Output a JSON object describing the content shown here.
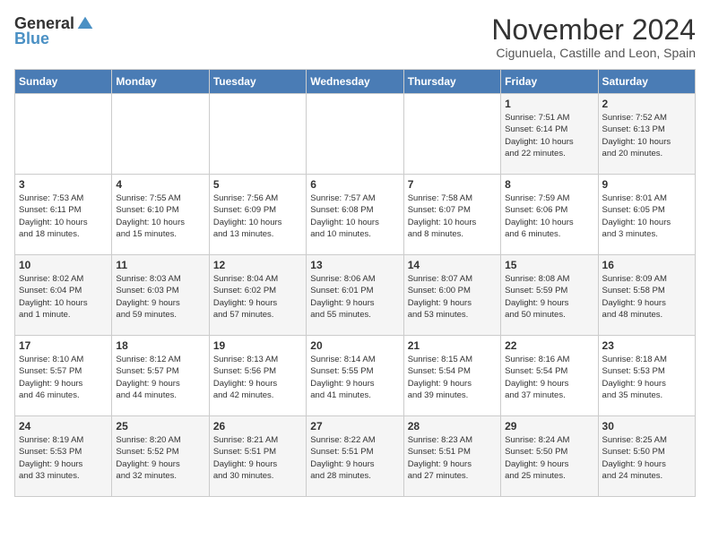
{
  "header": {
    "logo_general": "General",
    "logo_blue": "Blue",
    "month_title": "November 2024",
    "location": "Cigunuela, Castille and Leon, Spain"
  },
  "weekdays": [
    "Sunday",
    "Monday",
    "Tuesday",
    "Wednesday",
    "Thursday",
    "Friday",
    "Saturday"
  ],
  "weeks": [
    [
      {
        "day": "",
        "info": ""
      },
      {
        "day": "",
        "info": ""
      },
      {
        "day": "",
        "info": ""
      },
      {
        "day": "",
        "info": ""
      },
      {
        "day": "",
        "info": ""
      },
      {
        "day": "1",
        "info": "Sunrise: 7:51 AM\nSunset: 6:14 PM\nDaylight: 10 hours\nand 22 minutes."
      },
      {
        "day": "2",
        "info": "Sunrise: 7:52 AM\nSunset: 6:13 PM\nDaylight: 10 hours\nand 20 minutes."
      }
    ],
    [
      {
        "day": "3",
        "info": "Sunrise: 7:53 AM\nSunset: 6:11 PM\nDaylight: 10 hours\nand 18 minutes."
      },
      {
        "day": "4",
        "info": "Sunrise: 7:55 AM\nSunset: 6:10 PM\nDaylight: 10 hours\nand 15 minutes."
      },
      {
        "day": "5",
        "info": "Sunrise: 7:56 AM\nSunset: 6:09 PM\nDaylight: 10 hours\nand 13 minutes."
      },
      {
        "day": "6",
        "info": "Sunrise: 7:57 AM\nSunset: 6:08 PM\nDaylight: 10 hours\nand 10 minutes."
      },
      {
        "day": "7",
        "info": "Sunrise: 7:58 AM\nSunset: 6:07 PM\nDaylight: 10 hours\nand 8 minutes."
      },
      {
        "day": "8",
        "info": "Sunrise: 7:59 AM\nSunset: 6:06 PM\nDaylight: 10 hours\nand 6 minutes."
      },
      {
        "day": "9",
        "info": "Sunrise: 8:01 AM\nSunset: 6:05 PM\nDaylight: 10 hours\nand 3 minutes."
      }
    ],
    [
      {
        "day": "10",
        "info": "Sunrise: 8:02 AM\nSunset: 6:04 PM\nDaylight: 10 hours\nand 1 minute."
      },
      {
        "day": "11",
        "info": "Sunrise: 8:03 AM\nSunset: 6:03 PM\nDaylight: 9 hours\nand 59 minutes."
      },
      {
        "day": "12",
        "info": "Sunrise: 8:04 AM\nSunset: 6:02 PM\nDaylight: 9 hours\nand 57 minutes."
      },
      {
        "day": "13",
        "info": "Sunrise: 8:06 AM\nSunset: 6:01 PM\nDaylight: 9 hours\nand 55 minutes."
      },
      {
        "day": "14",
        "info": "Sunrise: 8:07 AM\nSunset: 6:00 PM\nDaylight: 9 hours\nand 53 minutes."
      },
      {
        "day": "15",
        "info": "Sunrise: 8:08 AM\nSunset: 5:59 PM\nDaylight: 9 hours\nand 50 minutes."
      },
      {
        "day": "16",
        "info": "Sunrise: 8:09 AM\nSunset: 5:58 PM\nDaylight: 9 hours\nand 48 minutes."
      }
    ],
    [
      {
        "day": "17",
        "info": "Sunrise: 8:10 AM\nSunset: 5:57 PM\nDaylight: 9 hours\nand 46 minutes."
      },
      {
        "day": "18",
        "info": "Sunrise: 8:12 AM\nSunset: 5:57 PM\nDaylight: 9 hours\nand 44 minutes."
      },
      {
        "day": "19",
        "info": "Sunrise: 8:13 AM\nSunset: 5:56 PM\nDaylight: 9 hours\nand 42 minutes."
      },
      {
        "day": "20",
        "info": "Sunrise: 8:14 AM\nSunset: 5:55 PM\nDaylight: 9 hours\nand 41 minutes."
      },
      {
        "day": "21",
        "info": "Sunrise: 8:15 AM\nSunset: 5:54 PM\nDaylight: 9 hours\nand 39 minutes."
      },
      {
        "day": "22",
        "info": "Sunrise: 8:16 AM\nSunset: 5:54 PM\nDaylight: 9 hours\nand 37 minutes."
      },
      {
        "day": "23",
        "info": "Sunrise: 8:18 AM\nSunset: 5:53 PM\nDaylight: 9 hours\nand 35 minutes."
      }
    ],
    [
      {
        "day": "24",
        "info": "Sunrise: 8:19 AM\nSunset: 5:53 PM\nDaylight: 9 hours\nand 33 minutes."
      },
      {
        "day": "25",
        "info": "Sunrise: 8:20 AM\nSunset: 5:52 PM\nDaylight: 9 hours\nand 32 minutes."
      },
      {
        "day": "26",
        "info": "Sunrise: 8:21 AM\nSunset: 5:51 PM\nDaylight: 9 hours\nand 30 minutes."
      },
      {
        "day": "27",
        "info": "Sunrise: 8:22 AM\nSunset: 5:51 PM\nDaylight: 9 hours\nand 28 minutes."
      },
      {
        "day": "28",
        "info": "Sunrise: 8:23 AM\nSunset: 5:51 PM\nDaylight: 9 hours\nand 27 minutes."
      },
      {
        "day": "29",
        "info": "Sunrise: 8:24 AM\nSunset: 5:50 PM\nDaylight: 9 hours\nand 25 minutes."
      },
      {
        "day": "30",
        "info": "Sunrise: 8:25 AM\nSunset: 5:50 PM\nDaylight: 9 hours\nand 24 minutes."
      }
    ]
  ]
}
